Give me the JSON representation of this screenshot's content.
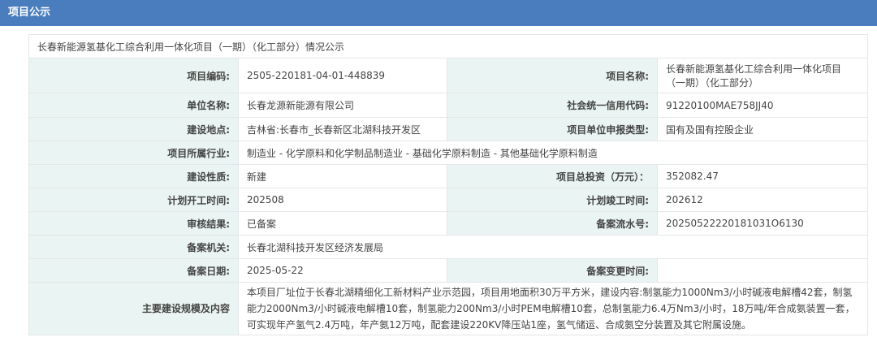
{
  "header": {
    "title": "项目公示"
  },
  "caption": "长春新能源氢基化工综合利用一体化项目（一期）（化工部分）情况公示",
  "rows": {
    "project_code_label": "项目编码:",
    "project_code": "2505-220181-04-01-448839",
    "project_name_label": "项目名称:",
    "project_name": "长春新能源氢基化工综合利用一体化项目（一期）（化工部分）",
    "unit_name_label": "单位名称:",
    "unit_name": "长春龙源新能源有限公司",
    "credit_code_label": "社会统一信用代码:",
    "credit_code": "91220100MAE758JJ40",
    "location_label": "建设地点:",
    "location": "吉林省:长春市_长春新区北湖科技开发区",
    "declare_type_label": "项目单位申报类型:",
    "declare_type": "国有及国有控股企业",
    "industry_label": "项目所属行业:",
    "industry": "制造业 - 化学原料和化学制品制造业 - 基础化学原料制造 - 其他基础化学原料制造",
    "nature_label": "建设性质:",
    "nature": "新建",
    "investment_label": "项目总投资（万元）：",
    "investment": "352082.47",
    "plan_start_label": "计划开工时间:",
    "plan_start": "202508",
    "plan_finish_label": "计划竣工时间:",
    "plan_finish": "202612",
    "review_label": "审核结果:",
    "review": "已备案",
    "serial_label": "备案流水号:",
    "serial": "20250522220181031O6130",
    "authority_label": "备案机关:",
    "authority": "长春北湖科技开发区经济发展局",
    "date_label": "备案日期:",
    "date": "2025-05-22",
    "change_time_label": "备案变更时间:",
    "change_time": "",
    "scale_label": "主要建设规模及内容",
    "scale": "本项目厂址位于长春北湖精细化工新材料产业示范园，项目用地面积30万平方米，建设内容:制氢能力1000Nm3/小时碱液电解槽42套，制氢能力2000Nm3/小时碱液电解槽10套，制氢能力200Nm3/小时PEM电解槽10套，总制氢能力6.4万Nm3/小时，18万吨/年合成氨装置一套，可实现年产氢气2.4万吨，年产氨12万吨，配套建设220KV降压站1座，氢气储运、合成氨空分装置及其它附属设施。"
  }
}
